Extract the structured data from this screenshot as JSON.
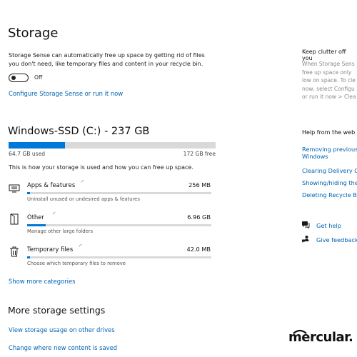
{
  "page_title": "Storage",
  "storage_sense": {
    "description_line1": "Storage Sense can automatically free up space by getting rid of files",
    "description_line2": "you don't need, like temporary files and content in your recycle bin.",
    "toggle_state": "Off",
    "configure_link": "Configure Storage Sense or run it now"
  },
  "drive": {
    "title": "Windows-SSD (C:) - 237 GB",
    "used": "64.7 GB used",
    "free": "172 GB free",
    "used_fraction": 0.273,
    "usage_caption": "This is how your storage is used and how you can free up space.",
    "categories": [
      {
        "name": "Apps & features",
        "size": "256 MB",
        "hint": "Uninstall unused or undesired apps & features",
        "icon": "apps-icon",
        "fill_fraction": 0.01
      },
      {
        "name": "Other",
        "size": "6.96 GB",
        "hint": "Manage other large folders",
        "icon": "other-folder-icon",
        "fill_fraction": 0.1
      },
      {
        "name": "Temporary files",
        "size": "42.0 MB",
        "hint": "Choose which temporary files to remove",
        "icon": "trash-icon",
        "fill_fraction": 0.01
      }
    ],
    "show_more": "Show more categories"
  },
  "more_settings": {
    "title": "More storage settings",
    "links": [
      "View storage usage on other drives",
      "Change where new content is saved"
    ]
  },
  "side": {
    "clutter_heading": "Keep clutter off you",
    "clutter_text": [
      "When Storage Sens",
      "free up space only",
      "low on space. To cle",
      "now, select Configu",
      "or run it now > Clea"
    ],
    "help_heading": "Help from the web",
    "help_links": [
      "Removing previous",
      "Windows",
      "Clearing Delivery O",
      "Showing/hiding the",
      "Deleting Recycle Bi"
    ],
    "get_help": "Get help",
    "give_feedback": "Give feedback"
  },
  "watermark": "mercular."
}
